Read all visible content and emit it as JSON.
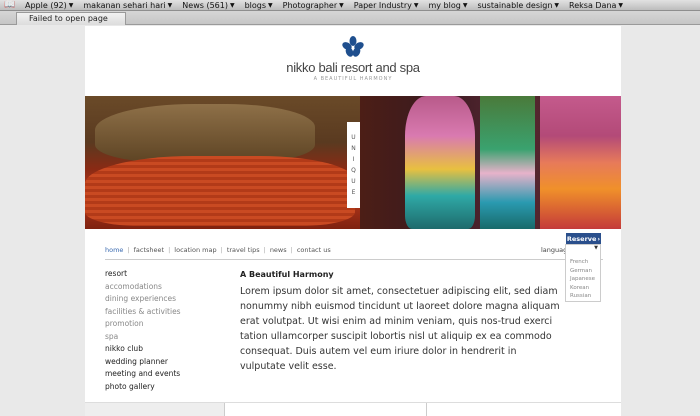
{
  "bookmarks": [
    {
      "label": "Apple (92)",
      "has_menu": true
    },
    {
      "label": "makanan sehari hari",
      "has_menu": true
    },
    {
      "label": "News (561)",
      "has_menu": true
    },
    {
      "label": "blogs",
      "has_menu": true
    },
    {
      "label": "Photographer",
      "has_menu": true
    },
    {
      "label": "Paper Industry",
      "has_menu": true
    },
    {
      "label": "my blog",
      "has_menu": true
    },
    {
      "label": "sustainable design",
      "has_menu": true
    },
    {
      "label": "Reksa Dana",
      "has_menu": true
    }
  ],
  "status_tab": "Failed to open page",
  "site": {
    "name": "nikko bali resort and spa",
    "tagline": "A BEAUTIFUL HARMONY",
    "accent": "#2a4f8c"
  },
  "hero": {
    "vertical_label": [
      "U",
      "N",
      "I",
      "Q",
      "U",
      "E"
    ]
  },
  "nav": [
    "home",
    "factsheet",
    "location map",
    "travel tips",
    "news",
    "contact us"
  ],
  "reserve_label": "Reserve",
  "language": {
    "label": "language",
    "options": [
      "French",
      "German",
      "Japanese",
      "Korean",
      "Russian"
    ]
  },
  "menu": [
    {
      "label": "resort",
      "level": "main"
    },
    {
      "label": "accomodations",
      "level": "sub"
    },
    {
      "label": "dining experiences",
      "level": "sub"
    },
    {
      "label": "facilities & activities",
      "level": "sub"
    },
    {
      "label": "promotion",
      "level": "sub"
    },
    {
      "label": "spa",
      "level": "sub"
    },
    {
      "label": "nikko club",
      "level": "main"
    },
    {
      "label": "wedding planner",
      "level": "main"
    },
    {
      "label": "meeting and events",
      "level": "main"
    },
    {
      "label": "photo gallery",
      "level": "main"
    }
  ],
  "content": {
    "title": "A Beautiful Harmony",
    "body": "Lorem ipsum dolor sit amet, consectetuer adipiscing elit, sed diam nonummy nibh euismod tincidunt ut laoreet dolore magna aliquam erat volutpat. Ut wisi enim ad minim veniam, quis nos-trud exerci tation ullamcorper suscipit lobortis nisl ut aliquip ex ea commodo consequat. Duis autem vel eum iriure dolor in hendrerit in vulputate velit esse."
  }
}
